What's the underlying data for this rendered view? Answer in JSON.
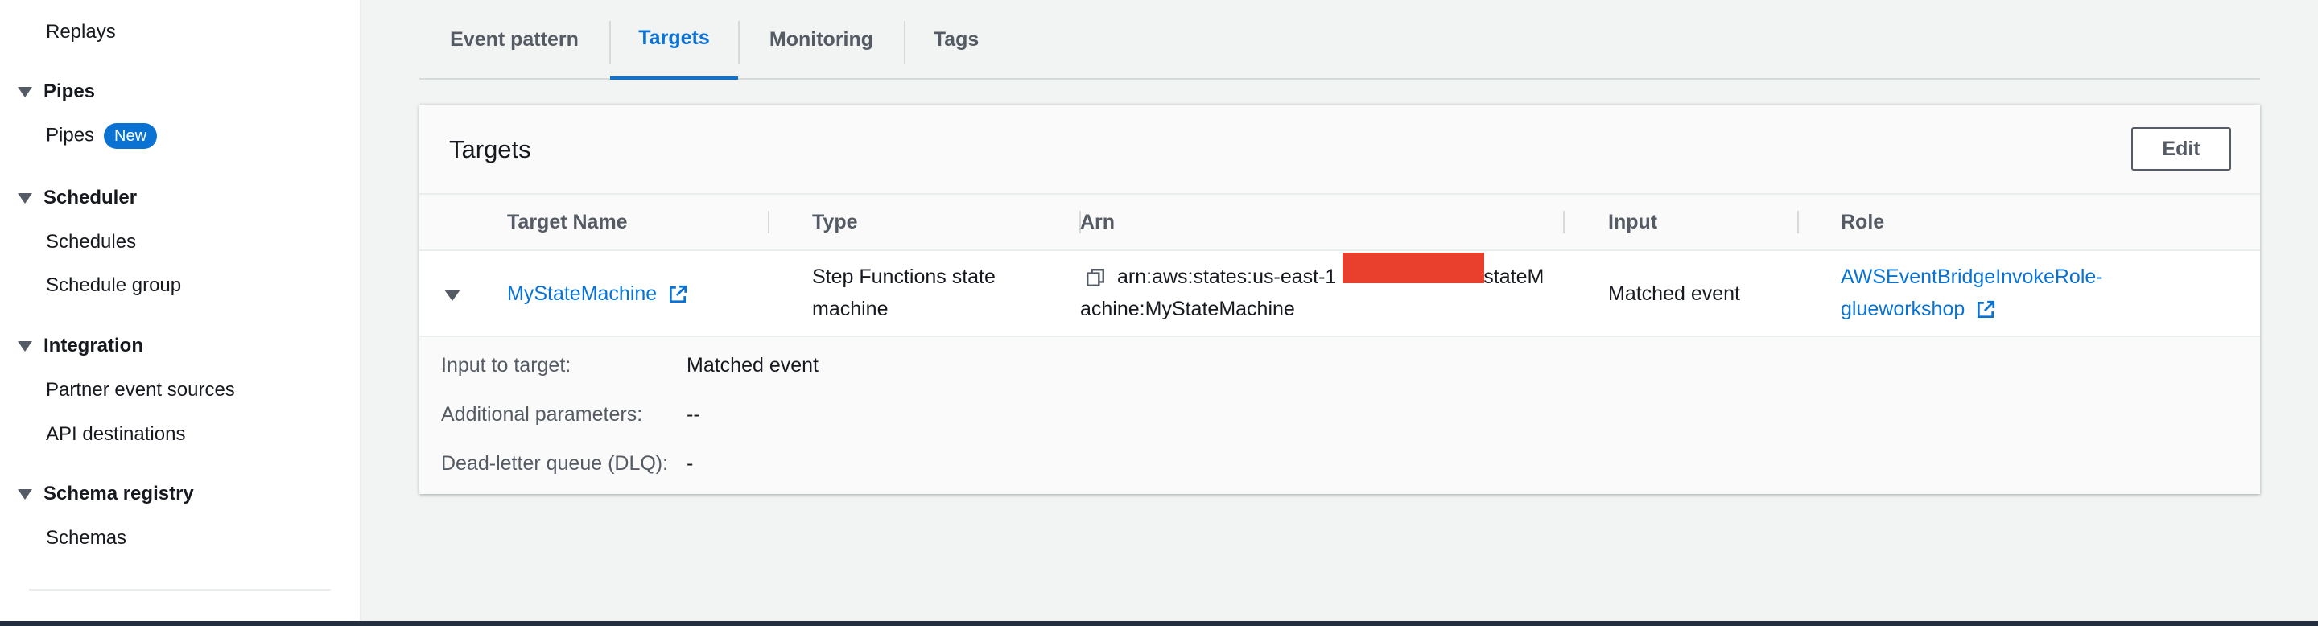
{
  "sidebar": {
    "replays": "Replays",
    "pipes_section": "Pipes",
    "pipes_link": "Pipes",
    "pipes_badge": "New",
    "scheduler_section": "Scheduler",
    "schedules": "Schedules",
    "schedule_group": "Schedule group",
    "integration_section": "Integration",
    "partner_event_sources": "Partner event sources",
    "api_destinations": "API destinations",
    "schema_registry_section": "Schema registry",
    "schemas": "Schemas"
  },
  "tabs": [
    {
      "label": "Event pattern",
      "active": false
    },
    {
      "label": "Targets",
      "active": true
    },
    {
      "label": "Monitoring",
      "active": false
    },
    {
      "label": "Tags",
      "active": false
    }
  ],
  "panel": {
    "title": "Targets",
    "edit_label": "Edit",
    "columns": [
      "Target Name",
      "Type",
      "Arn",
      "Input",
      "Role"
    ],
    "row": {
      "target_name": "MyStateMachine",
      "type_line1": "Step Functions state",
      "type_line2": "machine",
      "arn_line1": "arn:aws:states:us-east-1",
      "arn_line1_end": ":stateM",
      "arn_line2": "achine:MyStateMachine",
      "input": "Matched event",
      "role_line1": "AWSEventBridgeInvokeRole-",
      "role_line2": "glueworkshop"
    },
    "details": {
      "input_label": "Input to target:",
      "input_value": "Matched event",
      "params_label": "Additional parameters:",
      "params_value": "--",
      "dlq_label": "Dead-letter queue (DLQ):",
      "dlq_value": "-"
    }
  },
  "colors": {
    "accent": "#0972d3",
    "redaction": "#e8402d"
  }
}
